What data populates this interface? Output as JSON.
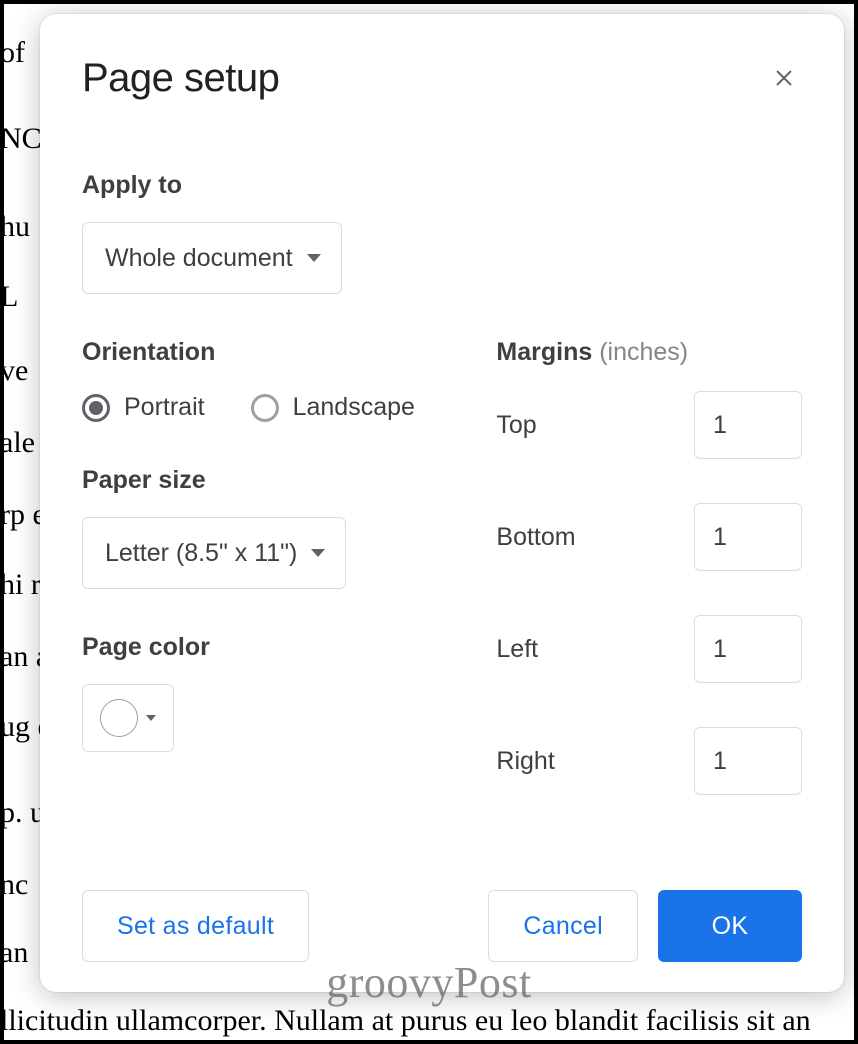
{
  "bg": {
    "l1": "of",
    "l2": "NC",
    "l3": "hu",
    "l4": "                                                                                                                                                  L",
    "l5": "                                                                                                                                                ve",
    "l6": "ale                                                                                                                                            us",
    "l7": "rp                                                                                                                                              e",
    "l8": "hi                                                                                                                                            rp",
    "l9": "an                                                                                                                                            a",
    "l10": "ug                                                                                                                                           ec",
    "l11": "p.                                                                                                                                           us",
    "l12": "nc",
    "l13": "                                                                                                                                             an",
    "l14": "llicitudin ullamcorper. Nullam at purus eu leo blandit facilisis sit an"
  },
  "dialog": {
    "title": "Page setup",
    "apply": {
      "label": "Apply to",
      "value": "Whole document"
    },
    "orientation": {
      "label": "Orientation",
      "portrait": "Portrait",
      "landscape": "Landscape",
      "selected": "portrait"
    },
    "paper": {
      "label": "Paper size",
      "value": "Letter (8.5\" x 11\")"
    },
    "color": {
      "label": "Page color",
      "hex": "#ffffff"
    },
    "margins": {
      "heading": "Margins",
      "unit": "(inches)",
      "top": {
        "label": "Top",
        "value": "1"
      },
      "bottom": {
        "label": "Bottom",
        "value": "1"
      },
      "left": {
        "label": "Left",
        "value": "1"
      },
      "right": {
        "label": "Right",
        "value": "1"
      }
    },
    "buttons": {
      "default": "Set as default",
      "cancel": "Cancel",
      "ok": "OK"
    }
  },
  "watermark": "groovyPost"
}
